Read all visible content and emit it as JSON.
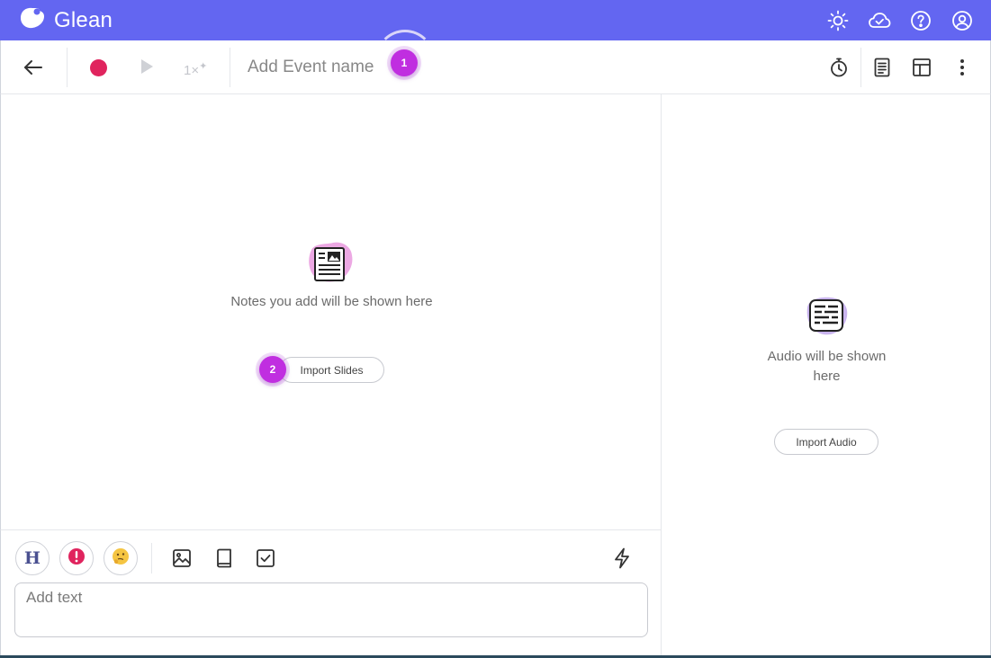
{
  "app": {
    "name": "Glean",
    "brand_color": "#6366f1"
  },
  "topbar": {
    "icons": [
      "sun-icon",
      "cloud-check-icon",
      "help-icon",
      "account-icon"
    ]
  },
  "toolbar": {
    "speed_value": "1×",
    "speed_sup": "✦",
    "event_placeholder": "Add Event name",
    "hint_1": "1",
    "right_icons": [
      "timer-icon",
      "document-icon",
      "layout-icon",
      "more-icon"
    ],
    "record_color": "#e0245e"
  },
  "notes": {
    "empty_text": "Notes you add will be shown here",
    "import_slides_label": "Import Slides",
    "hint_2": "2"
  },
  "audio": {
    "empty_text_line1": "Audio will be shown",
    "empty_text_line2": "here",
    "import_audio_label": "Import Audio"
  },
  "editor": {
    "heading_label": "H",
    "text_placeholder": "Add text"
  }
}
